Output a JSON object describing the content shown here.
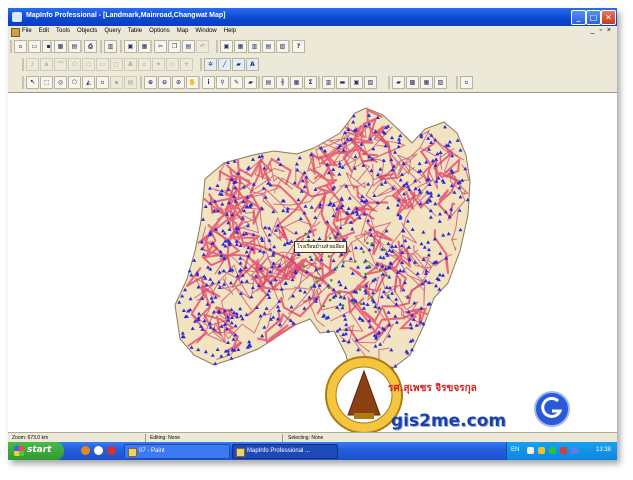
{
  "window": {
    "title": "MapInfo Professional - [Landmark,Mainroad,Changwat Map]",
    "controls": [
      "_",
      "□",
      "✕"
    ]
  },
  "menu": {
    "items": [
      "File",
      "Edit",
      "Tools",
      "Objects",
      "Query",
      "Table",
      "Options",
      "Map",
      "Window",
      "Help"
    ],
    "mdi_controls": [
      "_",
      "▫",
      "×"
    ]
  },
  "map": {
    "callout_text": "โรงเรียนบ้านหัวยเอียง",
    "watermark_title": "รศ.สุเพชร จิรขจรกุล",
    "watermark_url": "gis2me.com",
    "colors": {
      "province_fill": "#f2e3c1",
      "roads": "#e8506e",
      "landmarks": "#2a2ad8"
    }
  },
  "status": {
    "zoom": "Zoom: 673.0 km",
    "editing": "Editing: None",
    "selecting": "Selecting: None"
  },
  "taskbar": {
    "start_label": "start",
    "tasks": [
      "07 - Paint",
      "MapInfo Professional ..."
    ],
    "language": "EN",
    "clock": "13:38"
  },
  "icons": {
    "app": "mapinfo-globe-icon",
    "toolbar_main": [
      "new-icon",
      "open-icon",
      "save-icon",
      "print-icon",
      "cut-icon",
      "copy-icon",
      "paste-icon",
      "undo-icon",
      "help-icon"
    ],
    "toolbar_draw": [
      "line-icon",
      "polyline-icon",
      "arc-icon",
      "polygon-icon",
      "ellipse-icon",
      "rectangle-icon",
      "text-icon",
      "symbol-icon"
    ],
    "toolbar_main_tools": [
      "select-icon",
      "marquee-icon",
      "radius-icon",
      "polygon-select-icon",
      "boundary-icon",
      "zoom-in-icon",
      "zoom-out-icon",
      "pan-icon",
      "info-icon",
      "ruler-icon"
    ]
  }
}
